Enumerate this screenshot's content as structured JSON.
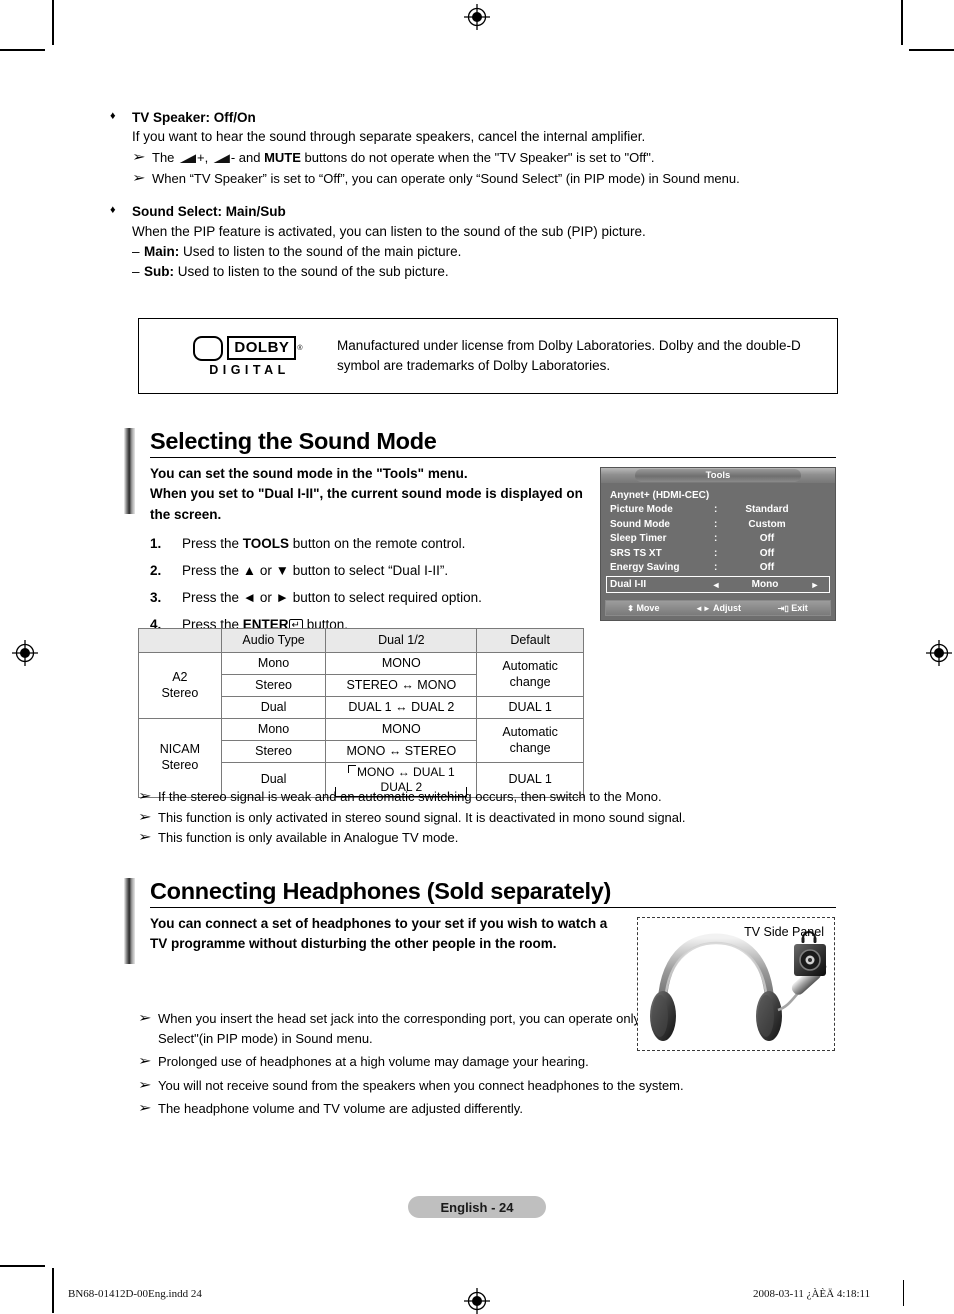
{
  "page": {
    "footer_badge": "English - 24",
    "print_file": "BN68-01412D-00Eng.indd   24",
    "print_timestamp": "2008-03-11   ¿ÀÈÄ 4:18:11"
  },
  "glyphs": {
    "diamond": "♦",
    "arrow_marker": "➢",
    "dash": "‒",
    "up": "▲",
    "down": "▼",
    "left": "◄",
    "right": "►",
    "updown": "♦",
    "enter": "↵"
  },
  "tv_speaker": {
    "heading": "TV Speaker: Off/On",
    "body": "If you want to hear the sound through separate speakers, cancel the internal amplifier.",
    "notes_pre": "The ",
    "notes_mid": "+, ",
    "notes_mute": "MUTE",
    "notes_post": " buttons do not operate when the \"TV Speaker\" is set to \"Off\".",
    "notes_minus": "- and ",
    "note2": "When “TV Speaker” is set to “Off”, you can operate only “Sound Select” (in PIP mode) in Sound menu."
  },
  "sound_select": {
    "heading": "Sound Select: Main/Sub",
    "body": "When the PIP feature is activated, you can listen to the sound of the sub (PIP) picture.",
    "main_label": "Main:",
    "main_text": " Used to listen to the sound of the main picture.",
    "sub_label": "Sub:",
    "sub_text": " Used to listen to the sound of the  sub picture."
  },
  "dolby": {
    "word": "DOLBY",
    "registered": "®",
    "sub": "DIGITAL",
    "text": "Manufactured under license from Dolby Laboratories. Dolby and the double-D symbol are trademarks of Dolby Laboratories."
  },
  "sound_mode": {
    "title": "Selecting the Sound Mode",
    "lead_1": "You can set the sound mode in the \"Tools\" menu.",
    "lead_2": "When you set to \"Dual I-II\", the current sound mode is displayed on the screen.",
    "steps": [
      {
        "num": "1.",
        "pre": "Press the ",
        "strong": "TOOLS",
        "post": " button on the remote control."
      },
      {
        "num": "2.",
        "pre": "Press the ▲ or ▼ button to select “Dual I-II”.",
        "strong": "",
        "post": ""
      },
      {
        "num": "3.",
        "pre": "Press the ◄ or ► button to select required option.",
        "strong": "",
        "post": ""
      },
      {
        "num": "4.",
        "pre": "Press the ",
        "strong": "ENTER",
        "post": " button."
      }
    ],
    "notes": [
      "If the stereo signal is weak and an automatic switching occurs, then switch to the Mono.",
      "This function is only activated in stereo sound signal. It is deactivated in mono sound signal.",
      "This function is only available in Analogue TV mode."
    ]
  },
  "osd": {
    "title": "Tools",
    "rows": [
      {
        "label": "Anynet+ (HDMI-CEC)",
        "colon": "",
        "value": ""
      },
      {
        "label": "Picture Mode",
        "colon": ":",
        "value": "Standard"
      },
      {
        "label": "Sound Mode",
        "colon": ":",
        "value": "Custom"
      },
      {
        "label": "Sleep Timer",
        "colon": ":",
        "value": "Off"
      },
      {
        "label": "SRS TS XT",
        "colon": ":",
        "value": "Off"
      },
      {
        "label": "Energy Saving",
        "colon": ":",
        "value": "Off"
      }
    ],
    "highlight": {
      "label": "Dual I-II",
      "left": "◄",
      "value": "Mono",
      "right": "►"
    },
    "footer": {
      "move": "Move",
      "adjust": "Adjust",
      "exit": "Exit"
    }
  },
  "audio_table": {
    "headers": [
      "",
      "Audio Type",
      "Dual 1/2",
      "Default"
    ],
    "groups": [
      {
        "name_line1": "A2",
        "name_line2": "Stereo",
        "rows": [
          {
            "type": "Mono",
            "dual": "MONO",
            "default": "Automatic change",
            "default_span": 2
          },
          {
            "type": "Stereo",
            "dual": "STEREO ↔ MONO",
            "default": null
          },
          {
            "type": "Dual",
            "dual": "DUAL 1 ↔ DUAL 2",
            "default": "DUAL 1",
            "default_span": 1
          }
        ]
      },
      {
        "name_line1": "NICAM",
        "name_line2": "Stereo",
        "rows": [
          {
            "type": "Mono",
            "dual": "MONO",
            "default": "Automatic change",
            "default_span": 2
          },
          {
            "type": "Stereo",
            "dual": "MONO ↔ STEREO",
            "default": null
          },
          {
            "type": "Dual",
            "dual_top": "MONO ↔ DUAL 1",
            "dual_bottom": "DUAL 2",
            "default": "DUAL 1",
            "default_span": 1
          }
        ]
      }
    ]
  },
  "headphones": {
    "title": "Connecting Headphones (Sold separately)",
    "lead": "You can connect a set of headphones to your set if you wish to watch a TV programme without disturbing the other people in the room.",
    "figure_label": "TV Side Panel",
    "notes": [
      "When you insert the head set jack into the corresponding port, you can operate only \"Auto Volume\"  and \"Sound Select\"(in PIP mode)  in Sound menu.",
      "Prolonged use of headphones at a high volume may damage your hearing.",
      "You will not receive sound from the speakers when you connect headphones to the system.",
      "The headphone volume and TV volume are adjusted differently."
    ]
  }
}
